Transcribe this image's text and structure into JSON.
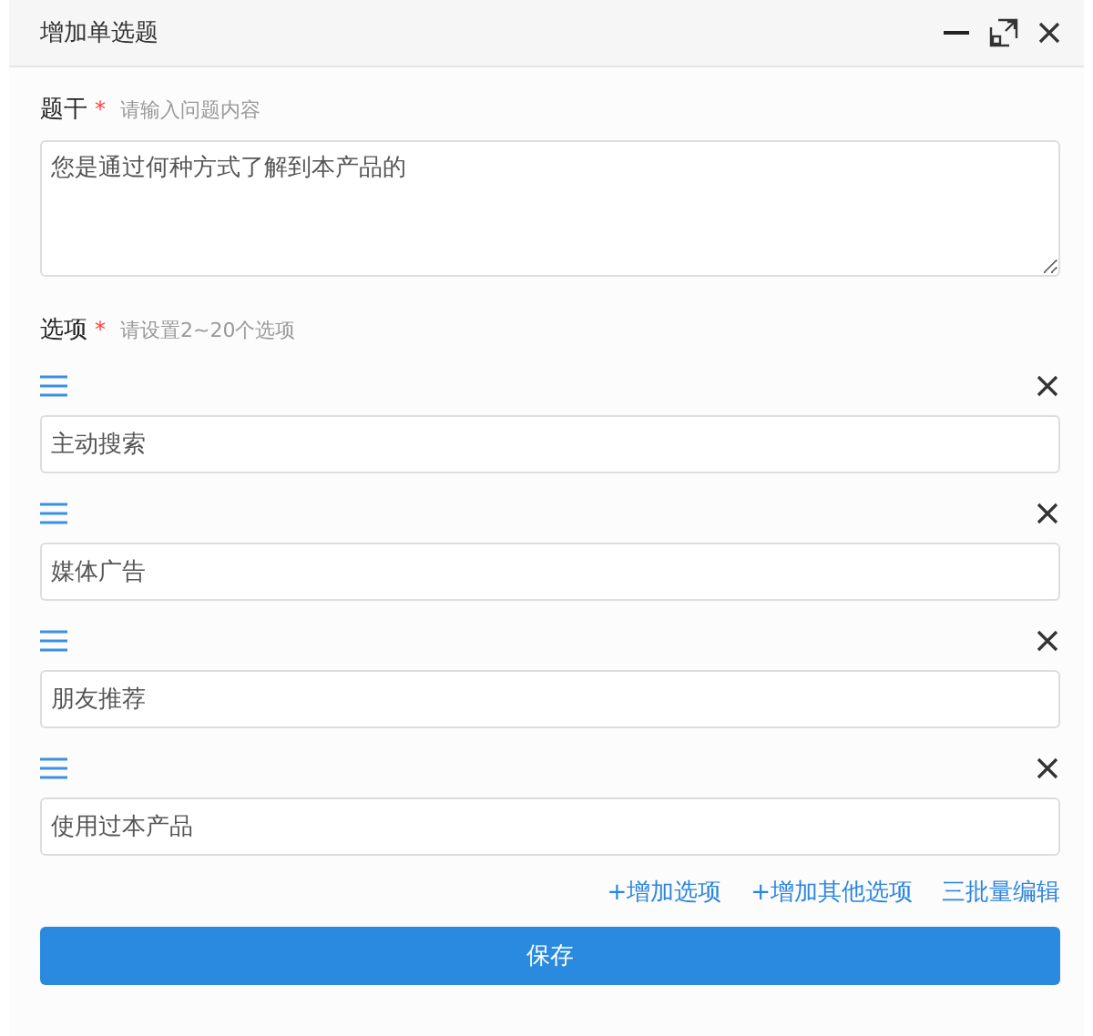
{
  "window": {
    "title": "增加单选题"
  },
  "stem": {
    "label": "题干",
    "required_mark": "*",
    "hint": "请输入问题内容",
    "value": "您是通过何种方式了解到本产品的"
  },
  "options_section": {
    "label": "选项",
    "required_mark": "*",
    "hint": "请设置2~20个选项"
  },
  "options": [
    {
      "value": "主动搜索"
    },
    {
      "value": "媒体广告"
    },
    {
      "value": "朋友推荐"
    },
    {
      "value": "使用过本产品"
    }
  ],
  "actions": [
    "+增加选项",
    "+增加其他选项",
    "三批量编辑"
  ],
  "save_button": "保存"
}
